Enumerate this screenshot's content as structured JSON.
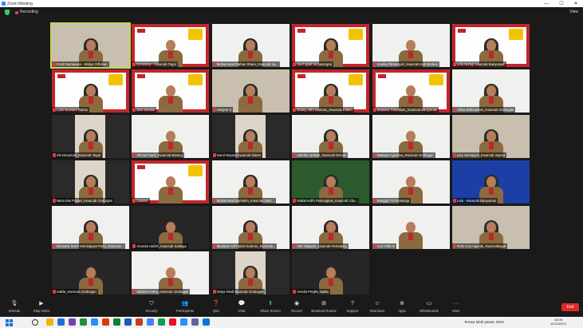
{
  "window": {
    "title": "Zoom Meeting",
    "controls": [
      "—",
      "☐",
      "✕"
    ]
  },
  "topbar": {
    "recording": "Recording",
    "view": "View"
  },
  "participants": [
    {
      "name": "Ferdi Darmawan - Widya Orfluhan",
      "bg": "room",
      "active": true
    },
    {
      "name": "RAHMAN - Kwarcab Tegal",
      "bg": "red"
    },
    {
      "name": "Muhammad Raihan Dharu_Kwarcab Ja...",
      "bg": "white"
    },
    {
      "name": "Arief Iqbal Suryaningrat",
      "bg": "red"
    },
    {
      "name": "Amelia Fitriansyah_Kwarcab Kab Brebes",
      "bg": "white"
    },
    {
      "name": "Lela Nurfuji Kwarcab Banyumas",
      "bg": "red"
    },
    {
      "name": "Lumi Nurviani Ratnia",
      "bg": "red"
    },
    {
      "name": "Dita Windari",
      "bg": "red"
    },
    {
      "name": "Hedyne S",
      "bg": "room"
    },
    {
      "name": "Dhany Adhi Santoso_Kwarcab Klaten",
      "bg": "red"
    },
    {
      "name": "Santana Trisnafiani_Kwarcab Banyumas",
      "bg": "red"
    },
    {
      "name": "Vikha Rahmadani_Kwarcab Grobogan",
      "bg": "white"
    },
    {
      "name": "Siti Istiqomah_Kwarcab Tegal",
      "bg": "cam"
    },
    {
      "name": "Ahmad Hanif_Kwarcab Batang",
      "bg": "white"
    },
    {
      "name": "Nurul Nupera Kwarcab Klaten",
      "bg": "cam"
    },
    {
      "name": "Adinda Larasati_Kwarcab Demak",
      "bg": "white"
    },
    {
      "name": "Natasya Agustina_Kwarcab Grobogan",
      "bg": "white"
    },
    {
      "name": "Liza Hendayati_Kwarcab Jepara",
      "bg": "room"
    },
    {
      "name": "Nesa Dwi Pratiwi_Kwarcab Grobogan",
      "bg": "cam"
    },
    {
      "name": "LENIVA",
      "bg": "red"
    },
    {
      "name": "Muhammad Nurhalim_Kwarcab Dem...",
      "bg": "white"
    },
    {
      "name": "Haikal Ardhi Pamungkas_Kwarcab Cila...",
      "bg": "green"
    },
    {
      "name": "Rangga Tri Purwanga",
      "bg": "white"
    },
    {
      "name": "Lela - Kwarcab Banyumas",
      "bg": "blue"
    },
    {
      "name": "Devanny Surel Herningtyas Putra_Kwarcab...",
      "bg": "white"
    },
    {
      "name": "Ananda Hafizh_Kwarcab Salatiga",
      "bg": "dark"
    },
    {
      "name": "Maulana Arif Faizal Subroto_Kwarcab...",
      "bg": "white"
    },
    {
      "name": "Anti Hidayah_Kwarcab Pemalang",
      "bg": "white"
    },
    {
      "name": "A12 mifta m",
      "bg": "white"
    },
    {
      "name": "Rizki Izza Aqarida_Kwarcabtegal",
      "bg": "room"
    },
    {
      "name": "nabila_Kwarcab Grobogan",
      "bg": "dark"
    },
    {
      "name": "Sabrina Farha_Kwarcab Grobogan",
      "bg": "white"
    },
    {
      "name": "Setya Nindi Kwarcab Grobogan",
      "bg": "cam"
    },
    {
      "name": "Amelia Pinglky Nadia",
      "bg": "dark"
    }
  ],
  "toolbar": {
    "items": [
      {
        "key": "unmute",
        "label": "Unmute",
        "icon": "🎙"
      },
      {
        "key": "video",
        "label": "Stop Video",
        "icon": "▶"
      },
      {
        "key": "security",
        "label": "Security",
        "icon": "⛉"
      },
      {
        "key": "participants",
        "label": "Participants",
        "icon": "👥"
      },
      {
        "key": "qa",
        "label": "Q&A",
        "icon": "❓"
      },
      {
        "key": "chat",
        "label": "Chat",
        "icon": "💬"
      },
      {
        "key": "share",
        "label": "Share Screen",
        "icon": "⬆"
      },
      {
        "key": "record",
        "label": "Record",
        "icon": "◉"
      },
      {
        "key": "breakout",
        "label": "Breakout Rooms",
        "icon": "⊞"
      },
      {
        "key": "support",
        "label": "Support",
        "icon": "?"
      },
      {
        "key": "reactions",
        "label": "Reactions",
        "icon": "☺"
      },
      {
        "key": "apps",
        "label": "Apps",
        "icon": "⊕"
      },
      {
        "key": "whiteboards",
        "label": "Whiteboards",
        "icon": "▭"
      },
      {
        "key": "more",
        "label": "More",
        "icon": "···"
      }
    ],
    "participants_count": "92",
    "end": "End"
  },
  "taskbar": {
    "tray_text": "Terasa lebih panas",
    "lang": "ENG",
    "time": "16:08",
    "date": "11/10/2023"
  },
  "colors": {
    "frame_red": "#c0262a",
    "active_border": "#c8d35a",
    "end_red": "#e02828",
    "share_green": "#2ecc71"
  }
}
